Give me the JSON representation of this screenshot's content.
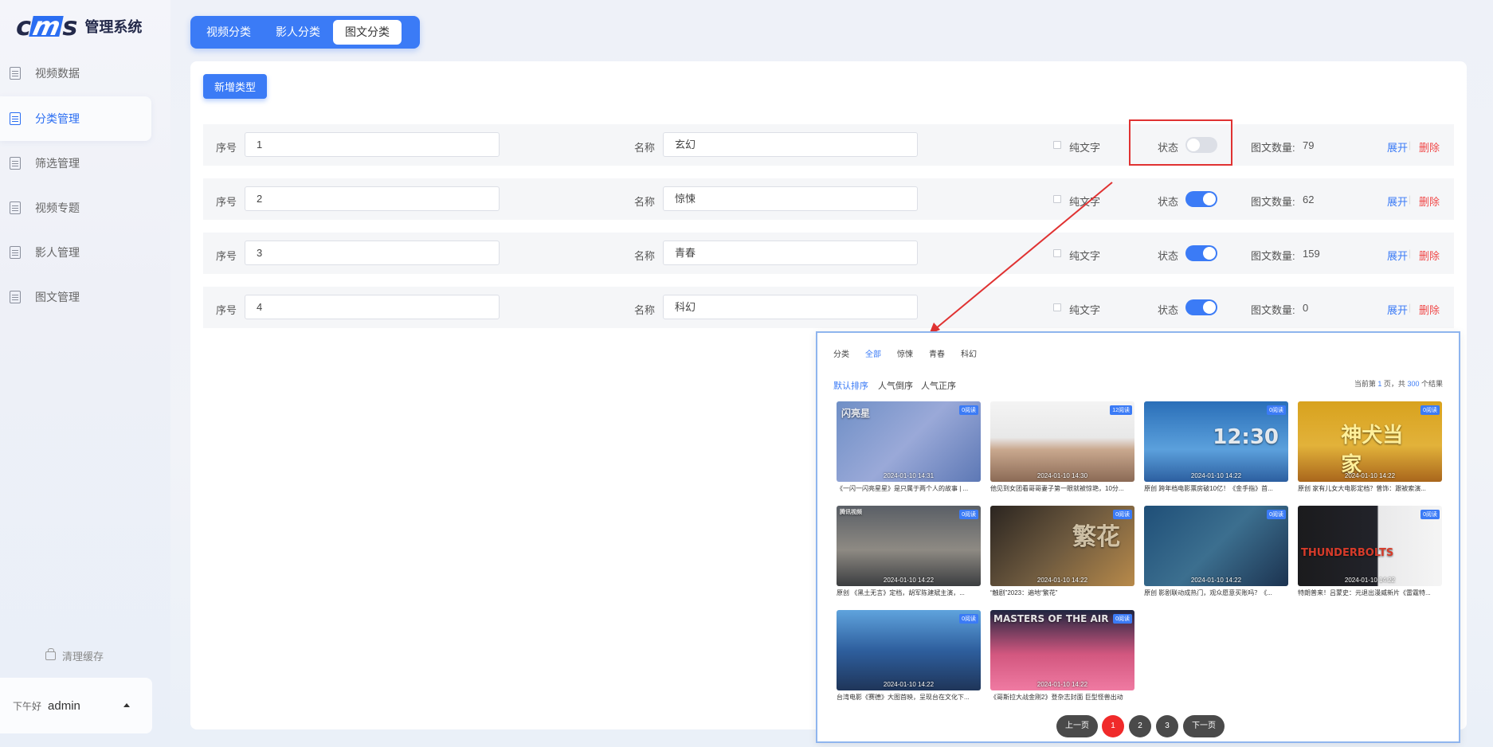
{
  "app": {
    "logo_text": "cms",
    "title": "管理系统"
  },
  "sidebar": {
    "items": [
      {
        "label": "视频数据",
        "icon": "document-icon"
      },
      {
        "label": "分类管理",
        "icon": "document-icon",
        "active": true
      },
      {
        "label": "筛选管理",
        "icon": "document-icon"
      },
      {
        "label": "视频专题",
        "icon": "document-icon"
      },
      {
        "label": "影人管理",
        "icon": "document-icon"
      },
      {
        "label": "图文管理",
        "icon": "document-icon"
      }
    ],
    "clear_cache": "清理缓存",
    "greeting": "下午好",
    "username": "admin"
  },
  "tabs": [
    {
      "label": "视频分类"
    },
    {
      "label": "影人分类"
    },
    {
      "label": "图文分类",
      "active": true
    }
  ],
  "toolbar": {
    "add_label": "新增类型"
  },
  "fields": {
    "index_label": "序号",
    "name_label": "名称",
    "text_only_label": "纯文字",
    "status_label": "状态",
    "count_label": "图文数量:",
    "expand_label": "展开",
    "delete_label": "删除",
    "separator": "|"
  },
  "categories": [
    {
      "index": "1",
      "name": "玄幻",
      "status": false,
      "count": "79"
    },
    {
      "index": "2",
      "name": "惊悚",
      "status": true,
      "count": "62"
    },
    {
      "index": "3",
      "name": "青春",
      "status": true,
      "count": "159"
    },
    {
      "index": "4",
      "name": "科幻",
      "status": true,
      "count": "0"
    }
  ],
  "preview": {
    "category_tabs": [
      "分类",
      "全部",
      "惊悚",
      "青春",
      "科幻"
    ],
    "sort_options": [
      "默认排序",
      "人气倒序",
      "人气正序"
    ],
    "total_text": {
      "prefix": "当前第",
      "page": "1",
      "mid": "页，共",
      "total": "300",
      "suffix": "个结果"
    },
    "cards": [
      {
        "title": "《一闪一闪亮星星》是只属于两个人的故事 | ...",
        "date": "2024-01-10 14:31",
        "tag": "0阅读",
        "deco": "闪亮星"
      },
      {
        "title": "他见到女团看哥哥妻子第一眼就被惊艳，10分...",
        "date": "2024-01-10 14:30",
        "tag": "12阅读",
        "deco": ""
      },
      {
        "title": "原创 跨年档电影票房破10亿！《金手指》首...",
        "date": "2024-01-10 14:22",
        "tag": "0阅读",
        "deco": "12:30"
      },
      {
        "title": "原创 家有儿女大电影定档？曾饰：跟被索演...",
        "date": "2024-01-10 14:22",
        "tag": "0阅读",
        "deco": "神犬当家"
      },
      {
        "title": "原创 《黑土无言》定档，胡军陈建斌主演，...",
        "date": "2024-01-10 14:22",
        "tag": "0阅读",
        "deco": "腾讯视频"
      },
      {
        "title": "“触剧”2023：遍地“繁花”",
        "date": "2024-01-10 14:22",
        "tag": "0阅读",
        "deco": "繁花"
      },
      {
        "title": "原创 影剧联动成热门，观众愿意买账吗？《...",
        "date": "2024-01-10 14:22",
        "tag": "0阅读",
        "deco": ""
      },
      {
        "title": "特朗普来！吕蒙史：元退出漫威新片《雷霆特...",
        "date": "2024-01-10 14:22",
        "tag": "0阅读",
        "deco": "THUNDERBOLTS"
      },
      {
        "title": "台湾电影《赛德》大图首映，呈现台在文化下...",
        "date": "2024-01-10 14:22",
        "tag": "0阅读",
        "deco": ""
      },
      {
        "title": "《哥斯拉大战金刚2》登杂志封面 巨型怪兽出动",
        "date": "2024-01-10 14:22",
        "tag": "0阅读",
        "deco": "MASTERS OF THE AIR"
      }
    ],
    "pagination": {
      "prev": "上一页",
      "pages": [
        "1",
        "2",
        "3"
      ],
      "next": "下一页",
      "current": "1"
    }
  },
  "colors": {
    "accent": "#3b7bf6",
    "danger": "#f04848",
    "highlight": "#e03232",
    "page_current": "#f02a2a"
  }
}
